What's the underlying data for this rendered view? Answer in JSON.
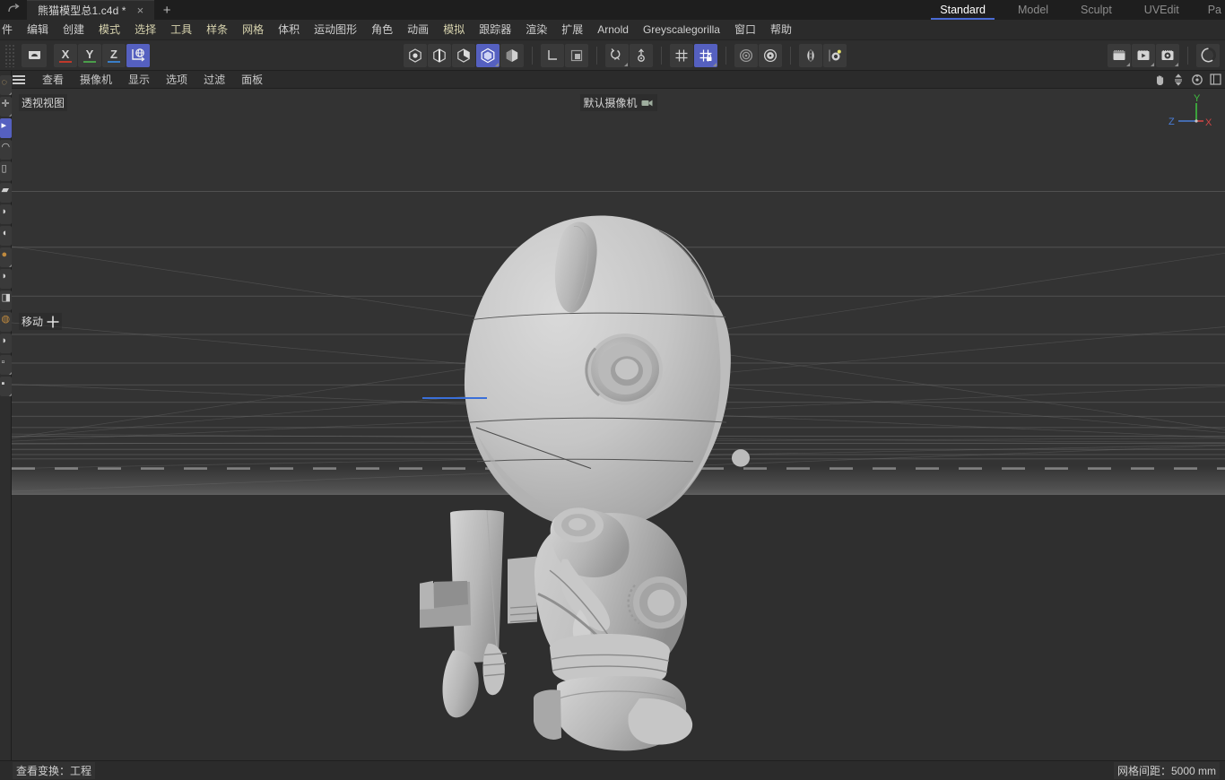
{
  "titlebar": {
    "undo_icon": "undo-arrow-icon",
    "document_tab": {
      "name": "熊猫模型总1.c4d *",
      "close": "×"
    },
    "new_tab": "+",
    "layout_tabs": [
      {
        "label": "Standard",
        "active": true
      },
      {
        "label": "Model",
        "active": false
      },
      {
        "label": "Sculpt",
        "active": false
      },
      {
        "label": "UVEdit",
        "active": false
      },
      {
        "label": "Pa",
        "active": false
      }
    ]
  },
  "menubar": {
    "items": [
      {
        "label": "件",
        "tint": false
      },
      {
        "label": "编辑",
        "tint": false
      },
      {
        "label": "创建",
        "tint": false
      },
      {
        "label": "模式",
        "tint": true
      },
      {
        "label": "选择",
        "tint": true
      },
      {
        "label": "工具",
        "tint": true
      },
      {
        "label": "样条",
        "tint": true
      },
      {
        "label": "网格",
        "tint": true
      },
      {
        "label": "体积",
        "tint": false
      },
      {
        "label": "运动图形",
        "tint": false
      },
      {
        "label": "角色",
        "tint": false
      },
      {
        "label": "动画",
        "tint": false
      },
      {
        "label": "模拟",
        "tint": true
      },
      {
        "label": "跟踪器",
        "tint": false
      },
      {
        "label": "渲染",
        "tint": false
      },
      {
        "label": "扩展",
        "tint": false
      },
      {
        "label": "Arnold",
        "tint": false
      },
      {
        "label": "Greyscalegorilla",
        "tint": false
      },
      {
        "label": "窗口",
        "tint": false
      },
      {
        "label": "帮助",
        "tint": false
      }
    ]
  },
  "toolbar": {
    "left_group": [
      {
        "name": "undo-redo-history-icon",
        "label": "",
        "active": false
      }
    ],
    "axis_locks": [
      {
        "label": "X",
        "color": "#c0392b",
        "active": false
      },
      {
        "label": "Y",
        "color": "#4a9e4a",
        "active": false
      },
      {
        "label": "Z",
        "color": "#3a7ec8",
        "active": false
      }
    ],
    "world_coord": {
      "name": "world-object-coordinate-icon",
      "active": true
    },
    "mode_group": [
      {
        "name": "point-mode-icon",
        "active": false
      },
      {
        "name": "edge-mode-icon",
        "active": false
      },
      {
        "name": "polygon-mode-icon",
        "active": false
      },
      {
        "name": "model-mode-icon",
        "active": true
      },
      {
        "name": "texture-mode-icon",
        "active": false
      }
    ],
    "axis_group": [
      {
        "name": "axis-mode-icon",
        "active": false
      },
      {
        "name": "enable-axis-icon",
        "active": false
      }
    ],
    "snap_group": [
      {
        "name": "quantize-icon",
        "active": false
      },
      {
        "name": "workplane-icon",
        "active": false
      },
      {
        "name": "snap-icon",
        "active": false
      },
      {
        "name": "snap-lock-icon",
        "active": true
      },
      {
        "name": "viewport-solo-icon",
        "active": false
      },
      {
        "name": "viewport-settings-icon",
        "active": false
      }
    ],
    "symmetry_group": [
      {
        "name": "symmetry-mirror-icon",
        "active": false
      },
      {
        "name": "modeling-settings-icon",
        "active": false
      }
    ],
    "render_group": [
      {
        "name": "render-view-icon",
        "active": false
      },
      {
        "name": "render-to-picture-viewer-icon",
        "active": false
      },
      {
        "name": "render-settings-icon",
        "active": false
      },
      {
        "name": "arnold-render-icon",
        "active": false
      }
    ]
  },
  "viewport_header": {
    "hamburger": "viewport-menu-icon",
    "menus": [
      "查看",
      "摄像机",
      "显示",
      "选项",
      "过滤",
      "面板"
    ],
    "nav_icons": [
      "pan-hand-icon",
      "dolly-icon",
      "rotate-icon",
      "maximize-view-icon"
    ]
  },
  "viewport": {
    "view_label": "透视视图",
    "camera_label": "默认摄像机",
    "camera_icon": "camera-icon",
    "tool_label": "移动",
    "tool_icon": "move-crosshair-icon",
    "axis_gizmo": {
      "y": {
        "label": "Y",
        "color": "#3fbf3f"
      },
      "x": {
        "label": "X",
        "color": "#d04545"
      },
      "z": {
        "label": "Z",
        "color": "#4a7ed8"
      }
    },
    "model_description": "灰色粘土渲染的卡通机器人熊猫角色模型",
    "background_color": "#333333",
    "floor_color": "#2f2f2f"
  },
  "statusbar": {
    "left": "查看变换：工程",
    "right": "网格间距：5000 mm"
  }
}
